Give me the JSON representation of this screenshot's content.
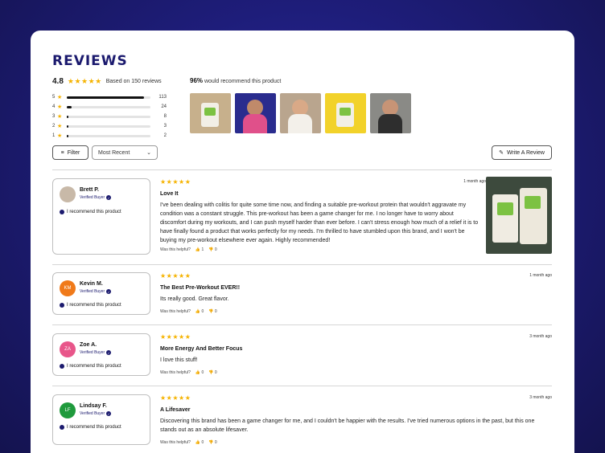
{
  "header": {
    "title": "REVIEWS"
  },
  "summary": {
    "rating": "4.8",
    "stars": "★★★★★",
    "based_on": "Based on 150 reviews",
    "distribution": [
      {
        "star": "5",
        "count": "113",
        "fraction": 0.92
      },
      {
        "star": "4",
        "count": "24",
        "fraction": 0.06
      },
      {
        "star": "3",
        "count": "8",
        "fraction": 0.02
      },
      {
        "star": "2",
        "count": "3",
        "fraction": 0.02
      },
      {
        "star": "1",
        "count": "2",
        "fraction": 0.02
      }
    ],
    "recommend_pct": "96%",
    "recommend_text": "would recommend this product"
  },
  "toolbar": {
    "filter_label": "Filter",
    "sort_value": "Most Recent",
    "write_label": "Write A Review"
  },
  "colors": {
    "accent": "#1b1a6e",
    "star": "#f5b301",
    "background": "#1e1d7a"
  },
  "reviews": [
    {
      "name": "Brett P.",
      "initials": "",
      "avatar_color": "#c8b9a8",
      "verified": "Verified Buyer",
      "recommend": "I recommend this product",
      "stars": "★★★★★",
      "date": "1 month ago",
      "title": "Love It",
      "body": "I've been dealing with colitis for quite some time now, and finding a suitable pre-workout protein that wouldn't aggravate my condition was a constant struggle. This pre-workout has been a game changer for me. I no longer have to worry about discomfort during my workouts, and I can push myself harder than ever before. I can't stress enough how much of a relief it is to have finally found a product that works perfectly for my needs. I'm thrilled to have stumbled upon this brand, and I won't be buying my pre-workout elsewhere ever again. Highly recommended!",
      "helpful_label": "Was this helpful?",
      "up": "1",
      "down": "0"
    },
    {
      "name": "Kevin M.",
      "initials": "KM",
      "avatar_color": "#f07a1a",
      "verified": "Verified Buyer",
      "recommend": "I recommend this product",
      "stars": "★★★★★",
      "date": "1 month ago",
      "title": "The Best Pre-Workout EVER!!",
      "body": "Its really good. Great flavor.",
      "helpful_label": "Was this helpful?",
      "up": "0",
      "down": "0"
    },
    {
      "name": "Zoe A.",
      "initials": "ZA",
      "avatar_color": "#e8568a",
      "verified": "Verified Buyer",
      "recommend": "I recommend this product",
      "stars": "★★★★★",
      "date": "3 month ago",
      "title": "More Energy And Better Focus",
      "body": "I love this stuff!",
      "helpful_label": "Was this helpful?",
      "up": "0",
      "down": "0"
    },
    {
      "name": "Lindsay F.",
      "initials": "LF",
      "avatar_color": "#1f9a3c",
      "verified": "Verified Buyer",
      "recommend": "I recommend this product",
      "stars": "★★★★★",
      "date": "3 month ago",
      "title": "A Lifesaver",
      "body": "Discovering this brand has been a game changer for me, and I couldn't be happier with the results. I've tried numerous options in the past, but this one stands out as an absolute lifesaver.",
      "helpful_label": "Was this helpful?",
      "up": "0",
      "down": "0"
    }
  ]
}
